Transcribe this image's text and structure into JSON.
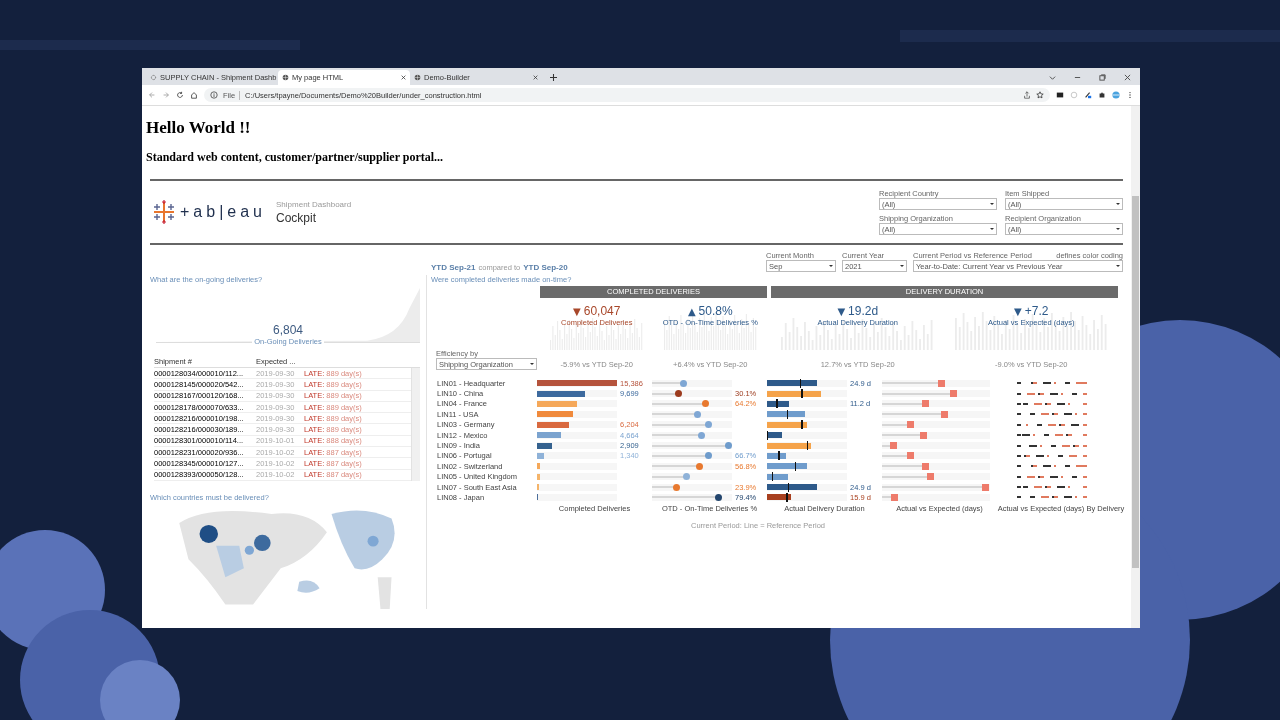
{
  "browser": {
    "tabs": [
      {
        "title": "SUPPLY CHAIN - Shipment Dashb",
        "selected": false
      },
      {
        "title": "My page HTML",
        "selected": true
      },
      {
        "title": "Demo-Builder",
        "selected": false
      }
    ],
    "address": {
      "scheme": "File",
      "url": "C:/Users/tpayne/Documents/Demo%20Builder/under_construction.html"
    }
  },
  "page": {
    "heading": "Hello World !!",
    "subheading": "Standard web content, customer/partner/supplier portal..."
  },
  "dashboard": {
    "logo": "+ab|eau",
    "subtitle": "Shipment Dashboard",
    "title": "Cockpit",
    "filters": [
      {
        "label": "Recipient Country",
        "value": "(All)"
      },
      {
        "label": "Item Shipped",
        "value": "(All)"
      },
      {
        "label": "Shipping Organization",
        "value": "(All)"
      },
      {
        "label": "Recipient Organization",
        "value": "(All)"
      }
    ],
    "period": {
      "current": "YTD Sep-21",
      "joiner": "compared to",
      "reference": "YTD Sep-20"
    },
    "controls": [
      {
        "label": "Current Month",
        "value": "Sep"
      },
      {
        "label": "Current Year",
        "value": "2021"
      },
      {
        "label": "Current Period vs Reference Period",
        "value": "Year-to-Date: Current Year vs Previous Year"
      }
    ],
    "color_note": "defines color coding",
    "ongoing": {
      "question": "What are the on-going deliveries?",
      "value": "6,804",
      "label": "On-Going Deliveries",
      "columns": [
        "Shipment #",
        "Expected ..."
      ],
      "rows": [
        {
          "shipment": "0000128034/000010/112...",
          "expected": "2019-09-30",
          "status": "LATE:",
          "days": "889 day(s)"
        },
        {
          "shipment": "0000128145/000020/542...",
          "expected": "2019-09-30",
          "status": "LATE:",
          "days": "889 day(s)"
        },
        {
          "shipment": "0000128167/000120/168...",
          "expected": "2019-09-30",
          "status": "LATE:",
          "days": "889 day(s)"
        },
        {
          "shipment": "0000128178/000070/633...",
          "expected": "2019-09-30",
          "status": "LATE:",
          "days": "889 day(s)"
        },
        {
          "shipment": "0000128216/000010/198...",
          "expected": "2019-09-30",
          "status": "LATE:",
          "days": "889 day(s)"
        },
        {
          "shipment": "0000128216/000030/189...",
          "expected": "2019-09-30",
          "status": "LATE:",
          "days": "889 day(s)"
        },
        {
          "shipment": "0000128301/000010/114...",
          "expected": "2019-10-01",
          "status": "LATE:",
          "days": "888 day(s)"
        },
        {
          "shipment": "0000128231/000020/936...",
          "expected": "2019-10-02",
          "status": "LATE:",
          "days": "887 day(s)"
        },
        {
          "shipment": "0000128345/000010/127...",
          "expected": "2019-10-02",
          "status": "LATE:",
          "days": "887 day(s)"
        },
        {
          "shipment": "0000128393/000050/128...",
          "expected": "2019-10-02",
          "status": "LATE:",
          "days": "887 day(s)"
        }
      ]
    },
    "map": {
      "question": "Which countries must be delivered?",
      "kind": "picture"
    },
    "completed": {
      "question": "Were completed deliveries made on-time?",
      "sections": [
        {
          "title": "COMPLETED DELIVERIES",
          "kpis": [
            {
              "arrow": "▼",
              "value": "60,047",
              "label": "Completed Deliveries",
              "delta": "-5.9% vs YTD Sep-20",
              "color": "#a8472a"
            },
            {
              "arrow": "▲",
              "value": "50.8%",
              "label": "OTD - On-Time Deliveries %",
              "delta": "+6.4% vs YTD Sep-20",
              "color": "#2e5a8a"
            }
          ]
        },
        {
          "title": "DELIVERY DURATION",
          "kpis": [
            {
              "arrow": "▼",
              "value": "19.2d",
              "label": "Actual Delivery Duration",
              "delta": "12.7% vs YTD Sep-20",
              "color": "#2e5a8a"
            },
            {
              "arrow": "▼",
              "value": "+7.2",
              "label": "Actual vs Expected (days)",
              "delta": "-9.0% vs YTD Sep-20",
              "color": "#2e5a8a"
            }
          ]
        }
      ],
      "efficiency": {
        "label": "Efficiency by",
        "value": "Shipping Organization"
      },
      "rows": [
        {
          "name": "LIN01 - Headquarter",
          "completed": {
            "level": 1,
            "color": "#b5533c",
            "label": "15,386"
          },
          "otd": {
            "level": 0.39,
            "color": "#7fa7d4"
          },
          "duration": {
            "level": 0.62,
            "color": "#2e5a8a",
            "label": "24.9 d",
            "reference": {
              "level": 0.42
            }
          },
          "vs": {
            "level": 0.55
          }
        },
        {
          "name": "LIN10 - China",
          "completed": {
            "level": 0.6,
            "color": "#3d6a9e",
            "label": "9,699"
          },
          "otd": {
            "level": 0.33,
            "color": "#9c3b1e",
            "label": "30.1%"
          },
          "duration": {
            "level": 0.68,
            "color": "#f5a34a",
            "reference": {
              "level": 0.44
            }
          },
          "vs": {
            "level": 0.66
          }
        },
        {
          "name": "LIN04 - France",
          "completed": {
            "level": 0.5,
            "color": "#f5a85a"
          },
          "otd": {
            "level": 0.67,
            "color": "#e8792f",
            "label": "64.2%"
          },
          "duration": {
            "level": 0.28,
            "color": "#2e5a8a",
            "label": "11.2 d",
            "reference": {
              "level": 0.13
            }
          },
          "vs": {
            "level": 0.4
          }
        },
        {
          "name": "LIN11 - USA",
          "completed": {
            "level": 0.45,
            "color": "#f08a3c"
          },
          "otd": {
            "level": 0.57,
            "color": "#7fa7d4"
          },
          "duration": {
            "level": 0.48,
            "color": "#6f9ccc",
            "reference": {
              "level": 0.26
            }
          },
          "vs": {
            "level": 0.58
          }
        },
        {
          "name": "LIN03 - Germany",
          "completed": {
            "level": 0.4,
            "color": "#d9693f",
            "label": "6,204"
          },
          "otd": {
            "level": 0.7,
            "color": "#7fa7d4"
          },
          "duration": {
            "level": 0.5,
            "color": "#f5a34a",
            "reference": {
              "level": 0.44
            }
          },
          "vs": {
            "level": 0.26
          }
        },
        {
          "name": "LIN12 - Mexico",
          "completed": {
            "level": 0.3,
            "color": "#7ba3cf",
            "label": "4,664"
          },
          "otd": {
            "level": 0.62,
            "color": "#7fa7d4"
          },
          "duration": {
            "level": 0.19,
            "color": "#2e5a8a",
            "reference": {
              "level": 0.01
            }
          },
          "vs": {
            "level": 0.38
          }
        },
        {
          "name": "LIN09 - India",
          "completed": {
            "level": 0.19,
            "color": "#35628f",
            "label": "2,909"
          },
          "otd": {
            "level": 0.96,
            "color": "#6f9ccc"
          },
          "duration": {
            "level": 0.55,
            "color": "#f5a34a",
            "reference": {
              "level": 0.51
            }
          },
          "vs": {
            "level": 0.11
          }
        },
        {
          "name": "LIN06 - Portugal",
          "completed": {
            "level": 0.09,
            "color": "#8fb2d8",
            "label": "1,340"
          },
          "otd": {
            "level": 0.7,
            "color": "#6f9ccc",
            "label": "66.7%"
          },
          "duration": {
            "level": 0.24,
            "color": "#6f9ccc",
            "reference": {
              "level": 0.15
            }
          },
          "vs": {
            "level": 0.26
          }
        },
        {
          "name": "LIN02 - Switzerland",
          "completed": {
            "level": 0.04,
            "color": "#f5a85a"
          },
          "otd": {
            "level": 0.59,
            "color": "#e8792f",
            "label": "56.8%"
          },
          "duration": {
            "level": 0.5,
            "color": "#6f9ccc",
            "reference": {
              "level": 0.36
            }
          },
          "vs": {
            "level": 0.4
          }
        },
        {
          "name": "LIN05 - United Kingdom",
          "completed": {
            "level": 0.035,
            "color": "#f5b46a"
          },
          "otd": {
            "level": 0.43,
            "color": "#8fb2d8"
          },
          "duration": {
            "level": 0.26,
            "color": "#6f9ccc",
            "reference": {
              "level": 0.07
            }
          },
          "vs": {
            "level": 0.45
          }
        },
        {
          "name": "LIN07 - South East Asia",
          "completed": {
            "level": 0.025,
            "color": "#f5b46a"
          },
          "otd": {
            "level": 0.3,
            "color": "#e8792f",
            "label": "23.9%"
          },
          "duration": {
            "level": 0.62,
            "color": "#2e5a8a",
            "label": "24.9 d",
            "reference": {
              "level": 0.27
            }
          },
          "vs": {
            "level": 0.96
          }
        },
        {
          "name": "LIN08 - Japan",
          "completed": {
            "level": 0.012,
            "color": "#4b6e9b"
          },
          "otd": {
            "level": 0.83,
            "color": "#24466e",
            "label": "79.4%"
          },
          "duration": {
            "level": 0.3,
            "color": "#a8401f",
            "label": "15.9 d",
            "reference": {
              "level": 0.25
            }
          },
          "vs": {
            "level": 0.12
          }
        }
      ],
      "axis_labels": [
        "Completed Deliveries",
        "OTD - On-Time Deliveries %",
        "Actual Delivery Duration",
        "Actual vs Expected (days)",
        "Actual vs Expected (days) By Delivery"
      ],
      "footnote": "Current Period: Line = Reference Period"
    }
  }
}
